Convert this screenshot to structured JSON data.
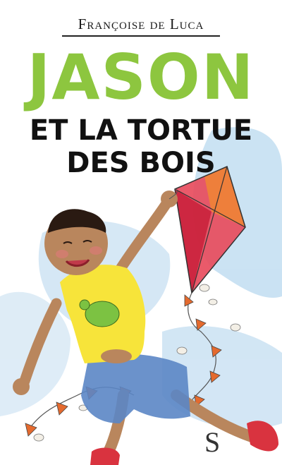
{
  "cover": {
    "author": "Françoise de Luca",
    "title_main": "JASON",
    "title_line1": "ET LA TORTUE",
    "title_line2": "DES BOIS",
    "publisher_mark": "S"
  },
  "colors": {
    "title_green": "#8dc63f",
    "watercolor_blue": "#a9cde8",
    "kite_red": "#d7263d",
    "shirt_yellow": "#f7e43a",
    "shorts_blue": "#5b86c5",
    "shoes_red": "#d9333f"
  }
}
